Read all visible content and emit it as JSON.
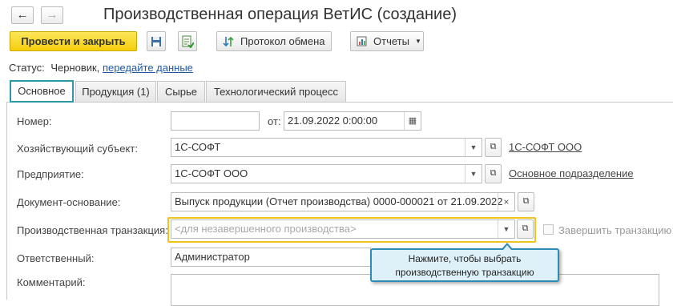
{
  "window": {
    "title": "Производственная операция ВетИС (создание)"
  },
  "nav": {
    "back_icon": "←",
    "forward_icon": "→"
  },
  "toolbar": {
    "post_close_label": "Провести и закрыть",
    "save_icon": "floppy-disk-icon",
    "post_icon": "post-document-icon",
    "exchange_log_label": "Протокол обмена",
    "reports_label": "Отчеты",
    "accent": "#f4cf0c"
  },
  "status": {
    "label": "Статус:",
    "value": "Черновик,",
    "link": "передайте данные"
  },
  "tabs": [
    {
      "label": "Основное"
    },
    {
      "label": "Продукция (1)"
    },
    {
      "label": "Сырье"
    },
    {
      "label": "Технологический процесс"
    }
  ],
  "form": {
    "number": {
      "label": "Номер:",
      "value": ""
    },
    "date": {
      "label": "от:",
      "value": "21.09.2022  0:00:00"
    },
    "entity": {
      "label": "Хозяйствующий субъект:",
      "value": "1С-СОФТ",
      "link": "1С-СОФТ ООО"
    },
    "enterprise": {
      "label": "Предприятие:",
      "value": "1С-СОФТ ООО",
      "link": "Основное подразделение"
    },
    "base_doc": {
      "label": "Документ-основание:",
      "value": "Выпуск продукции (Отчет производства) 0000-000021 от 21.09.2022"
    },
    "transaction": {
      "label": "Производственная транзакция:",
      "placeholder": "<для незавершенного производства>",
      "checkbox_label": "Завершить транзакцию"
    },
    "responsible": {
      "label": "Ответственный:",
      "value": "Администратор"
    },
    "comment": {
      "label": "Комментарий:",
      "value": ""
    }
  },
  "tooltip": {
    "line1": "Нажмите, чтобы выбрать",
    "line2": "производственную транзакцию"
  }
}
